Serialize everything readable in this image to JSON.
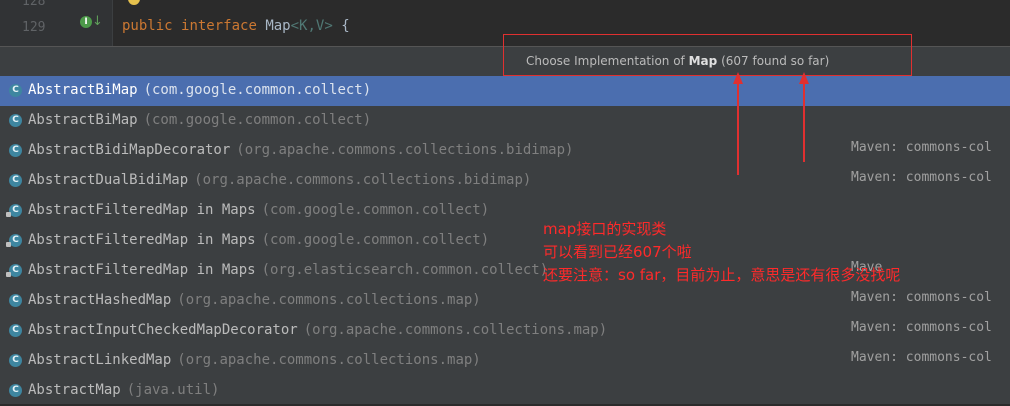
{
  "editor": {
    "line_numbers": [
      "128",
      "129"
    ],
    "code": {
      "kw1": "public",
      "kw2": "interface",
      "type": "Map",
      "generics": "<K,V>",
      "brace": "{"
    }
  },
  "popup": {
    "header_prefix": "Choose Implementation of ",
    "header_type": "Map",
    "header_suffix": " (607 found so far)",
    "items": [
      {
        "name": "AbstractBiMap",
        "pkg": "(com.google.common.collect)",
        "maven": "",
        "selected": true,
        "icon": "class-icon"
      },
      {
        "name": "AbstractBiMap",
        "pkg": "(com.google.common.collect)",
        "maven": "",
        "selected": false,
        "icon": "class-icon"
      },
      {
        "name": "AbstractBidiMapDecorator",
        "pkg": "(org.apache.commons.collections.bidimap)",
        "maven": "Maven: commons-col",
        "selected": false,
        "icon": "class-icon"
      },
      {
        "name": "AbstractDualBidiMap",
        "pkg": "(org.apache.commons.collections.bidimap)",
        "maven": "Maven: commons-col",
        "selected": false,
        "icon": "class-icon"
      },
      {
        "name": "AbstractFilteredMap in Maps",
        "pkg": "(com.google.common.collect)",
        "maven": "",
        "selected": false,
        "icon": "private-class-icon"
      },
      {
        "name": "AbstractFilteredMap in Maps",
        "pkg": "(com.google.common.collect)",
        "maven": "",
        "selected": false,
        "icon": "private-class-icon"
      },
      {
        "name": "AbstractFilteredMap in Maps",
        "pkg": "(org.elasticsearch.common.collect)",
        "maven": "Mave",
        "selected": false,
        "icon": "private-class-icon"
      },
      {
        "name": "AbstractHashedMap",
        "pkg": "(org.apache.commons.collections.map)",
        "maven": "Maven: commons-col",
        "selected": false,
        "icon": "class-icon"
      },
      {
        "name": "AbstractInputCheckedMapDecorator",
        "pkg": "(org.apache.commons.collections.map)",
        "maven": "Maven: commons-col",
        "selected": false,
        "icon": "class-icon"
      },
      {
        "name": "AbstractLinkedMap",
        "pkg": "(org.apache.commons.collections.map)",
        "maven": "Maven: commons-col",
        "selected": false,
        "icon": "class-icon"
      },
      {
        "name": "AbstractMap",
        "pkg": "(java.util)",
        "maven": "",
        "selected": false,
        "icon": "class-icon"
      }
    ]
  },
  "annotation": {
    "line1": "map接口的实现类",
    "line2": "可以看到已经607个啦",
    "line3": "还要注意：so far，目前为止，意思是还有很多没找呢"
  },
  "colors": {
    "selection": "#4b6eaf",
    "annotation": "#ff2a2a",
    "keyword": "#cc7832"
  }
}
